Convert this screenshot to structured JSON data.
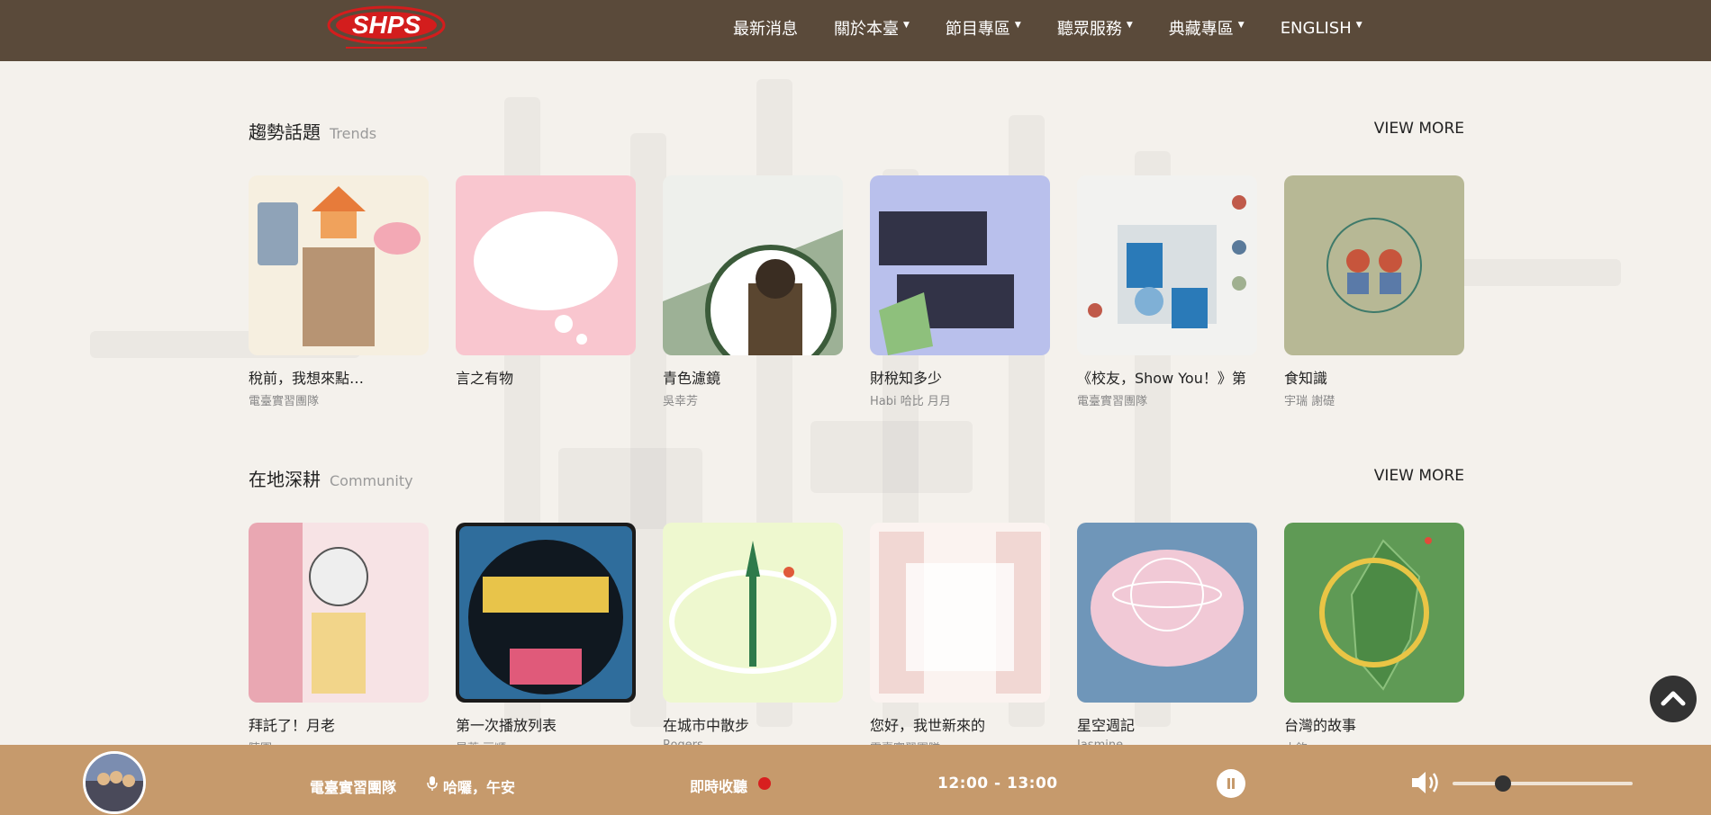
{
  "nav": {
    "items": [
      {
        "label": "最新消息",
        "dropdown": false
      },
      {
        "label": "關於本臺",
        "dropdown": true
      },
      {
        "label": "節目專區",
        "dropdown": true
      },
      {
        "label": "聽眾服務",
        "dropdown": true
      },
      {
        "label": "典藏專區",
        "dropdown": true
      },
      {
        "label": "ENGLISH",
        "dropdown": true
      }
    ]
  },
  "trends": {
    "title": "趨勢話題",
    "subtitle": "Trends",
    "view_more": "VIEW MORE",
    "cards": [
      {
        "title": "稅前，我想來點…",
        "author": "電臺實習團隊"
      },
      {
        "title": "言之有物",
        "author": ""
      },
      {
        "title": "青色濾鏡",
        "author": "吳幸芳"
      },
      {
        "title": "財稅知多少",
        "author": "Habi 哈比 月月"
      },
      {
        "title": "《校友，Show You！》第",
        "author": "電臺實習團隊"
      },
      {
        "title": "食知識",
        "author": "宇瑞 謝礎"
      }
    ]
  },
  "community": {
    "title": "在地深耕",
    "subtitle": "Community",
    "view_more": "VIEW MORE",
    "cards": [
      {
        "title": "拜託了！月老",
        "author": "陳園"
      },
      {
        "title": "第一次播放列表",
        "author": "晏蒂 豆順"
      },
      {
        "title": "在城市中散步",
        "author": "Rogers"
      },
      {
        "title": "您好，我世新來的",
        "author": "電臺實習團隊"
      },
      {
        "title": "星空週記",
        "author": "Jasmine"
      },
      {
        "title": "台灣的故事",
        "author": "小鈞"
      }
    ]
  },
  "player": {
    "host": "電臺實習團隊",
    "show": "哈囉，午安",
    "live_label": "即時收聽",
    "time": "12:00 - 13:00",
    "volume": 0.28,
    "live_color": "#d81f1f",
    "bar_color": "#c69a6c"
  },
  "icons": {
    "back_to_top": "chevron-up-icon",
    "mic": "microphone-icon",
    "pause": "pause-icon",
    "volume": "volume-icon"
  }
}
